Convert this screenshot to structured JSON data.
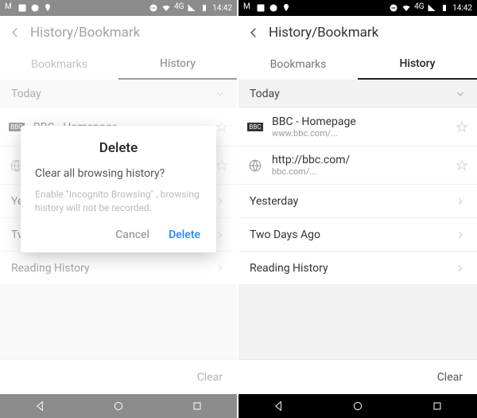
{
  "status": {
    "net": "4G",
    "time": "14:42"
  },
  "header": {
    "title": "History/Bookmark"
  },
  "tabs": {
    "bookmarks": "Bookmarks",
    "history": "History"
  },
  "sections": {
    "today": "Today",
    "yesterday": "Yesterday",
    "twodays": "Two Days Ago",
    "reading": "Reading History"
  },
  "entries": {
    "bbc_home": {
      "title": "BBC - Homepage",
      "url": "www.bbc.com/..."
    },
    "bbc_root": {
      "title": "http://bbc.com/",
      "url": "bbc.com/..."
    }
  },
  "left_peek": {
    "yesterday_initial": "Ye",
    "twodays_initial": "Tv"
  },
  "bottom": {
    "clear": "Clear"
  },
  "dialog": {
    "title": "Delete",
    "message": "Clear all browsing history?",
    "hint": "Enable \"Incognito Browsing\" , browsing history will not be recorded.",
    "cancel": "Cancel",
    "delete": "Delete"
  }
}
